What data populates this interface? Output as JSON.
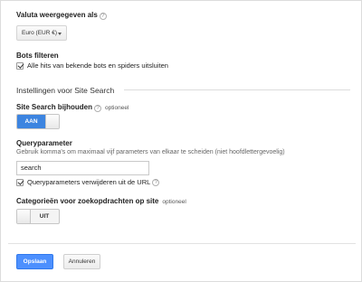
{
  "currency": {
    "label": "Valuta weergegeven als",
    "selected": "Euro (EUR €)"
  },
  "bots": {
    "label": "Bots filteren",
    "checkbox_label": "Alle hits van bekende bots en spiders uitsluiten",
    "checked": true
  },
  "site_search": {
    "section_title": "Instellingen voor Site Search",
    "tracking": {
      "label": "Site Search bijhouden",
      "optional": "optioneel",
      "toggle_label": "AAN",
      "state": "on"
    },
    "query_parameter": {
      "label": "Queryparameter",
      "hint": "Gebruik komma's om maximaal vijf parameters van elkaar te scheiden (niet hoofdlettergevoelig)",
      "value": "search",
      "strip_label": "Queryparameters verwijderen uit de URL",
      "strip_checked": true
    },
    "categories": {
      "label": "Categorieën voor zoekopdrachten op site",
      "optional": "optioneel",
      "toggle_label": "UIT",
      "state": "off"
    }
  },
  "actions": {
    "save_label": "Opslaan",
    "cancel_label": "Annuleren"
  },
  "help_glyph": "?",
  "colors": {
    "toggle_on": "#3c84e0",
    "primary_button": "#4d90fe"
  }
}
